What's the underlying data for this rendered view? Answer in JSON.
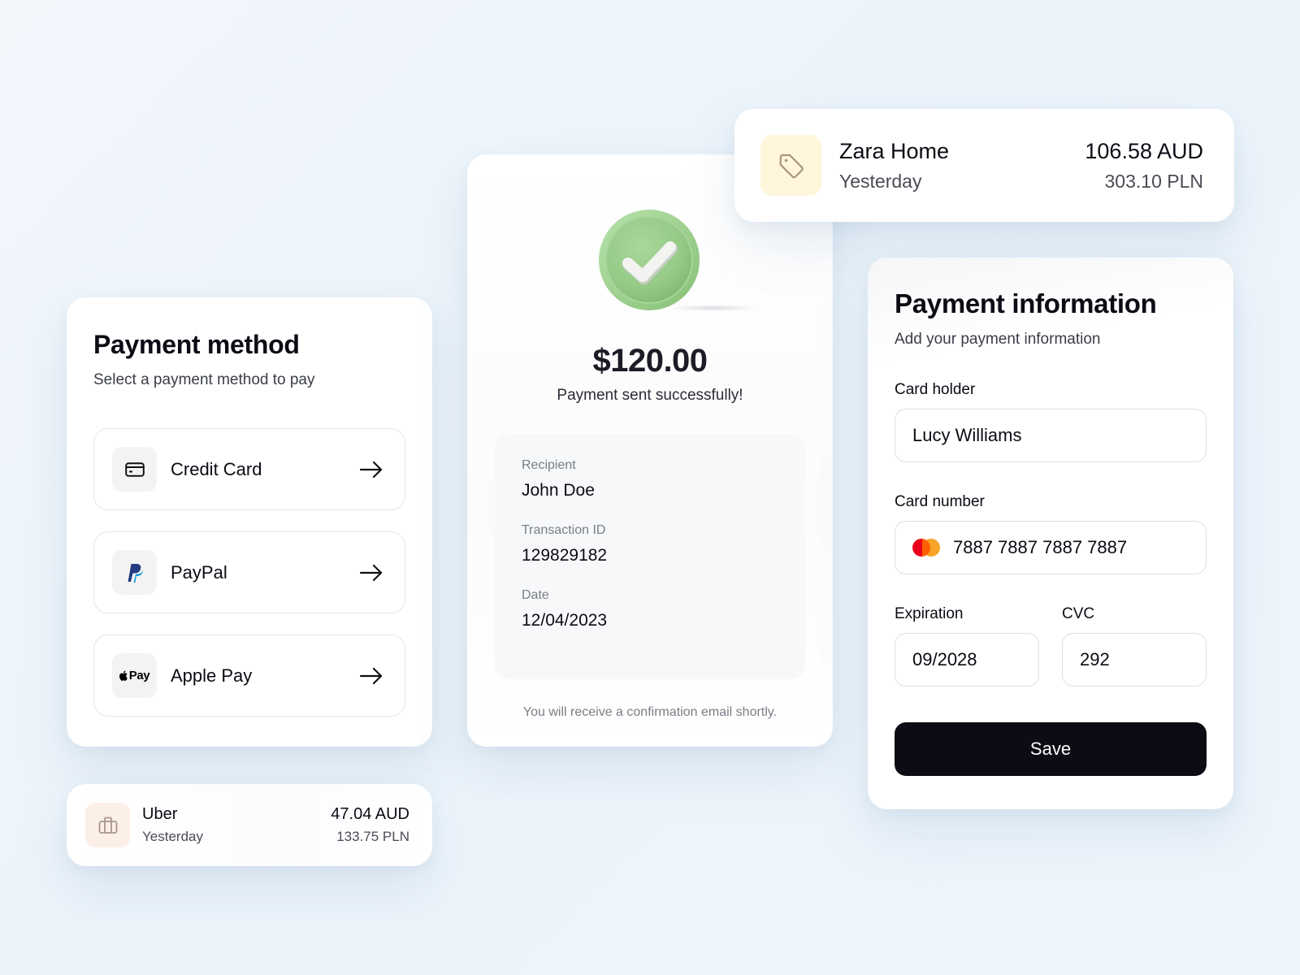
{
  "payment_method": {
    "title": "Payment method",
    "subtitle": "Select a payment method to pay",
    "methods": [
      {
        "label": "Credit Card",
        "icon": "credit-card-icon"
      },
      {
        "label": "PayPal",
        "icon": "paypal-logo-icon"
      },
      {
        "label": "Apple Pay",
        "icon": "apple-pay-logo-icon",
        "icon_text": "Pay"
      }
    ]
  },
  "transactions": [
    {
      "name": "Zara Home",
      "when": "Yesterday",
      "amount_aud": "106.58 AUD",
      "amount_pln": "303.10 PLN",
      "icon": "tag-icon",
      "icon_bg": "#fff6dc"
    },
    {
      "name": "Uber",
      "when": "Yesterday",
      "amount_aud": "47.04 AUD",
      "amount_pln": "133.75 PLN",
      "icon": "briefcase-icon",
      "icon_bg": "#fcefe8"
    }
  ],
  "success": {
    "amount": "$120.00",
    "message": "Payment sent successfully!",
    "details": [
      {
        "label": "Recipient",
        "value": "John Doe"
      },
      {
        "label": "Transaction ID",
        "value": "129829182"
      },
      {
        "label": "Date",
        "value": "12/04/2023"
      }
    ],
    "confirmation": "You will receive a confirmation email shortly.",
    "accent": "#93c887"
  },
  "payment_info": {
    "title": "Payment information",
    "subtitle": "Add your payment information",
    "card_holder": {
      "label": "Card holder",
      "value": "Lucy Williams"
    },
    "card_number": {
      "label": "Card number",
      "value": "7887 7887 7887 7887",
      "brand_icon": "mastercard-icon"
    },
    "expiration": {
      "label": "Expiration",
      "value": "09/2028"
    },
    "cvc": {
      "label": "CVC",
      "value": "292"
    },
    "save_label": "Save"
  }
}
